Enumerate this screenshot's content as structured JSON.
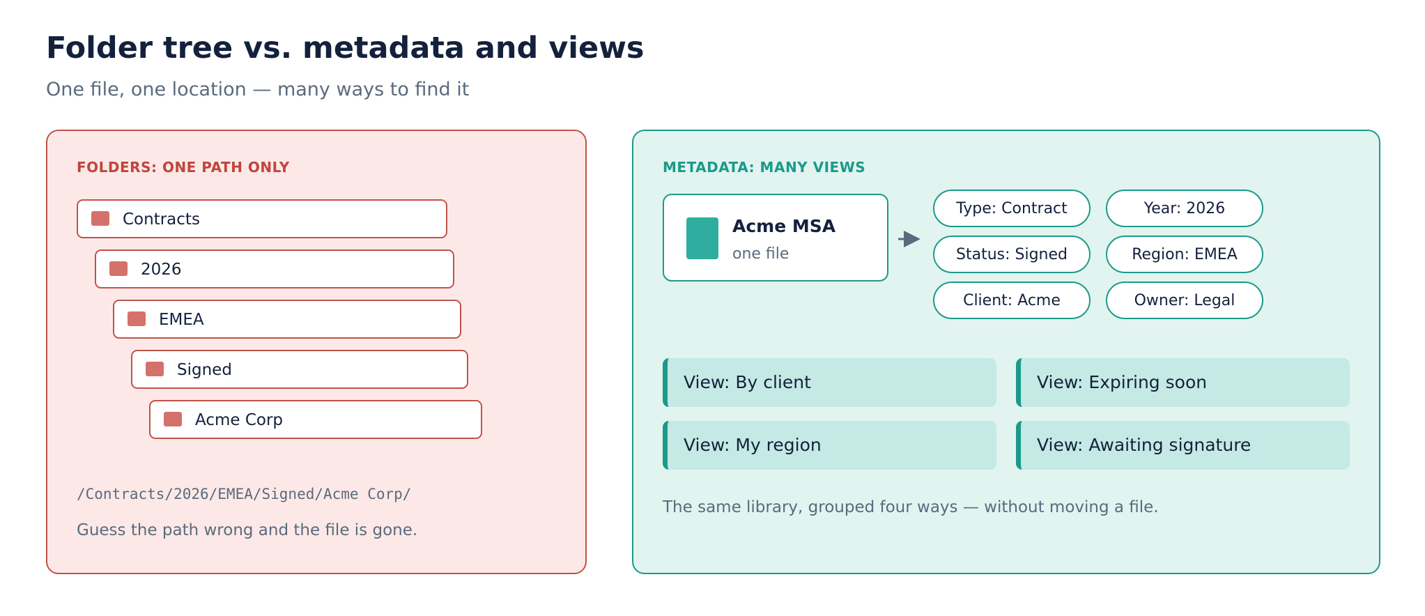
{
  "header": {
    "title": "Folder tree vs. metadata and views",
    "subtitle": "One file, one location — many ways to find it"
  },
  "folders_panel": {
    "label": "FOLDERS: ONE PATH ONLY",
    "folders": [
      "Contracts",
      "2026",
      "EMEA",
      "Signed",
      "Acme Corp"
    ],
    "folder_icon": "folder-icon",
    "path": "/Contracts/2026/EMEA/Signed/Acme Corp/",
    "note": "Guess the path wrong and the file is gone."
  },
  "metadata_panel": {
    "label": "METADATA: MANY VIEWS",
    "file": {
      "name": "Acme MSA",
      "subtitle": "one file",
      "icon": "document-icon"
    },
    "tags": [
      "Type: Contract",
      "Year: 2026",
      "Status: Signed",
      "Region: EMEA",
      "Client: Acme",
      "Owner: Legal"
    ],
    "views": [
      "View: By client",
      "View: Expiring soon",
      "View: My region",
      "View: Awaiting signature"
    ],
    "note": "The same library, grouped four ways — without moving a file."
  },
  "colors": {
    "folder_accent": "#c0534a",
    "metadata_accent": "#1a9a8b",
    "title_text": "#14213d",
    "muted_text": "#5a6a7e"
  }
}
